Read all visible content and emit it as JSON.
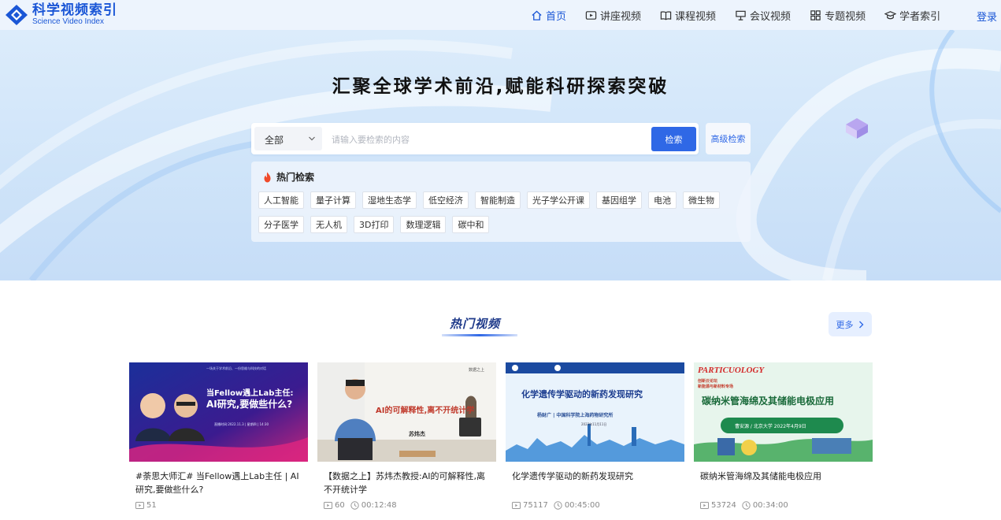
{
  "header": {
    "logo_cn": "科学视频索引",
    "logo_en": "Science Video Index",
    "nav": [
      {
        "label": "首页",
        "icon": "home-icon"
      },
      {
        "label": "讲座视频",
        "icon": "play-icon"
      },
      {
        "label": "课程视频",
        "icon": "book-icon"
      },
      {
        "label": "会议视频",
        "icon": "podium-icon"
      },
      {
        "label": "专题视频",
        "icon": "grid-icon"
      },
      {
        "label": "学者索引",
        "icon": "scholar-cap-icon"
      }
    ],
    "login_label": "登录"
  },
  "hero": {
    "title": "汇聚全球学术前沿,赋能科研探索突破",
    "search": {
      "scope_value": "全部",
      "placeholder": "请输入要检索的内容",
      "button_label": "检索",
      "advanced_label": "高级检索"
    },
    "hot_search": {
      "heading": "热门检索",
      "tags_row1": [
        "人工智能",
        "量子计算",
        "湿地生态学",
        "低空经济",
        "智能制造",
        "光子学公开课",
        "基因组学",
        "电池",
        "微生物"
      ],
      "tags_row2": [
        "分子医学",
        "无人机",
        "3D打印",
        "数理逻辑",
        "碳中和"
      ]
    }
  },
  "hot_videos": {
    "title": "热门视频",
    "more_label": "更多",
    "cards": [
      {
        "title": "#荼思大师汇# 当Fellow遇上Lab主任 | AI研究,要做些什么?",
        "views": "51",
        "duration": "",
        "thumb": {
          "headline1": "当Fellow遇上Lab主任:",
          "headline2": "AI研究,要做些什么?",
          "top_note": "一场关于学术前沿、一份思维与科技的对话",
          "time_note": "直播时间:2022.11.3 | 星期四 | 14:30"
        }
      },
      {
        "title": "【数据之上】苏炜杰教授:AI的可解释性,离不开统计学",
        "views": "60",
        "duration": "00:12:48",
        "thumb": {
          "headline": "AI的可解释性,离不开统计学",
          "name": "苏炜杰",
          "brand": "数据之上"
        }
      },
      {
        "title": "化学遗传学驱动的新药发现研究",
        "views": "75117",
        "duration": "00:45:00",
        "thumb": {
          "headline": "化学遗传学驱动的新药发现研究",
          "sub": "杨财广 | 中国科学院上海药物研究所",
          "date": "2023年11月11日"
        }
      },
      {
        "title": "碳纳米管海绵及其储能电极应用",
        "views": "53724",
        "duration": "00:34:00",
        "thumb": {
          "journal": "PARTICUOLOGY",
          "series1": "创新云论坛",
          "series2": "新能源与新材料专场",
          "headline": "碳纳米管海绵及其储能电极应用",
          "speaker": "曹安源 / 北京大学   2022年4月9日"
        }
      }
    ]
  },
  "colors": {
    "brand": "#1a56d6",
    "primary_button": "#2f68e6",
    "hot_icon": "#f04a2a"
  }
}
